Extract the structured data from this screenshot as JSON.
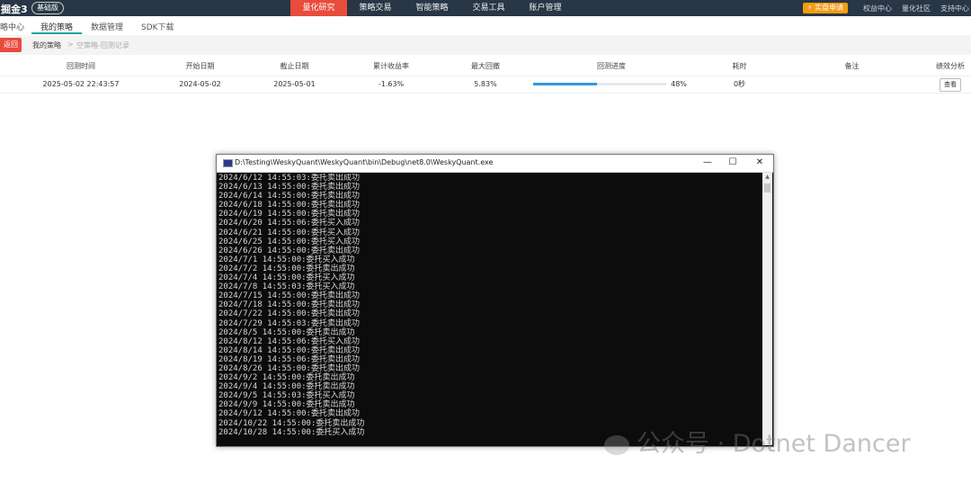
{
  "topbar": {
    "brand": "掘金3",
    "edition_badge": "基础版",
    "nav": [
      "量化研究",
      "策略交易",
      "智能策略",
      "交易工具",
      "账户管理"
    ],
    "active_nav": "量化研究",
    "buy_button": "⚡ 实盘申请",
    "right_links": [
      "权益中心",
      "量化社区",
      "支持中心"
    ]
  },
  "subnav": {
    "tabs": [
      "略中心",
      "我的策略",
      "数据管理",
      "SDK下载"
    ],
    "active_tab": "我的策略"
  },
  "breadcrumb": {
    "back_label": "返回",
    "items": [
      "我的策略",
      ">",
      "空策略-回测记录"
    ]
  },
  "table": {
    "columns": [
      "回测时间",
      "开始日期",
      "截止日期",
      "累计收益率",
      "最大回撤",
      "回测进度",
      "耗时",
      "备注",
      "绩效分析"
    ],
    "rows": [
      {
        "backtest_time": "2025-05-02 22:43:57",
        "start_date": "2024-05-02",
        "end_date": "2025-05-01",
        "cumulative_return": "-1.63%",
        "max_drawdown": "5.83%",
        "progress_label": "48%",
        "progress_value": 48,
        "elapsed": "0秒",
        "note": "",
        "action": "查看"
      }
    ]
  },
  "console": {
    "title": "D:\\Testing\\WeskyQuant\\WeskyQuant\\bin\\Debug\\net8.0\\WeskyQuant.exe",
    "minimize": "—",
    "maximize": "☐",
    "close": "✕",
    "lines": [
      "2024/6/12 14:55:03:委托卖出成功",
      "2024/6/13 14:55:00:委托卖出成功",
      "2024/6/14 14:55:00:委托卖出成功",
      "2024/6/18 14:55:00:委托卖出成功",
      "2024/6/19 14:55:00:委托卖出成功",
      "2024/6/20 14:55:06:委托买入成功",
      "2024/6/21 14:55:00:委托买入成功",
      "2024/6/25 14:55:00:委托买入成功",
      "2024/6/26 14:55:00:委托卖出成功",
      "2024/7/1 14:55:00:委托买入成功",
      "2024/7/2 14:55:00:委托卖出成功",
      "2024/7/4 14:55:00:委托买入成功",
      "2024/7/8 14:55:03:委托买入成功",
      "2024/7/15 14:55:00:委托卖出成功",
      "2024/7/18 14:55:00:委托卖出成功",
      "2024/7/22 14:55:00:委托卖出成功",
      "2024/7/29 14:55:03:委托卖出成功",
      "2024/8/5 14:55:00:委托卖出成功",
      "2024/8/12 14:55:06:委托买入成功",
      "2024/8/14 14:55:00:委托卖出成功",
      "2024/8/19 14:55:06:委托卖出成功",
      "2024/8/26 14:55:00:委托卖出成功",
      "2024/9/2 14:55:00:委托卖出成功",
      "2024/9/4 14:55:00:委托卖出成功",
      "2024/9/5 14:55:03:委托买入成功",
      "2024/9/9 14:55:00:委托卖出成功",
      "2024/9/12 14:55:00:委托卖出成功",
      "2024/10/22 14:55:00:委托卖出成功",
      "2024/10/28 14:55:00:委托买入成功"
    ]
  },
  "watermark": "公众号 · Dotnet Dancer",
  "colors": {
    "topbar_bg": "#283645",
    "accent_red": "#e84c3d",
    "buy_orange": "#f39c12",
    "progress_blue": "#3498db",
    "console_bg": "#0c0c0c"
  }
}
